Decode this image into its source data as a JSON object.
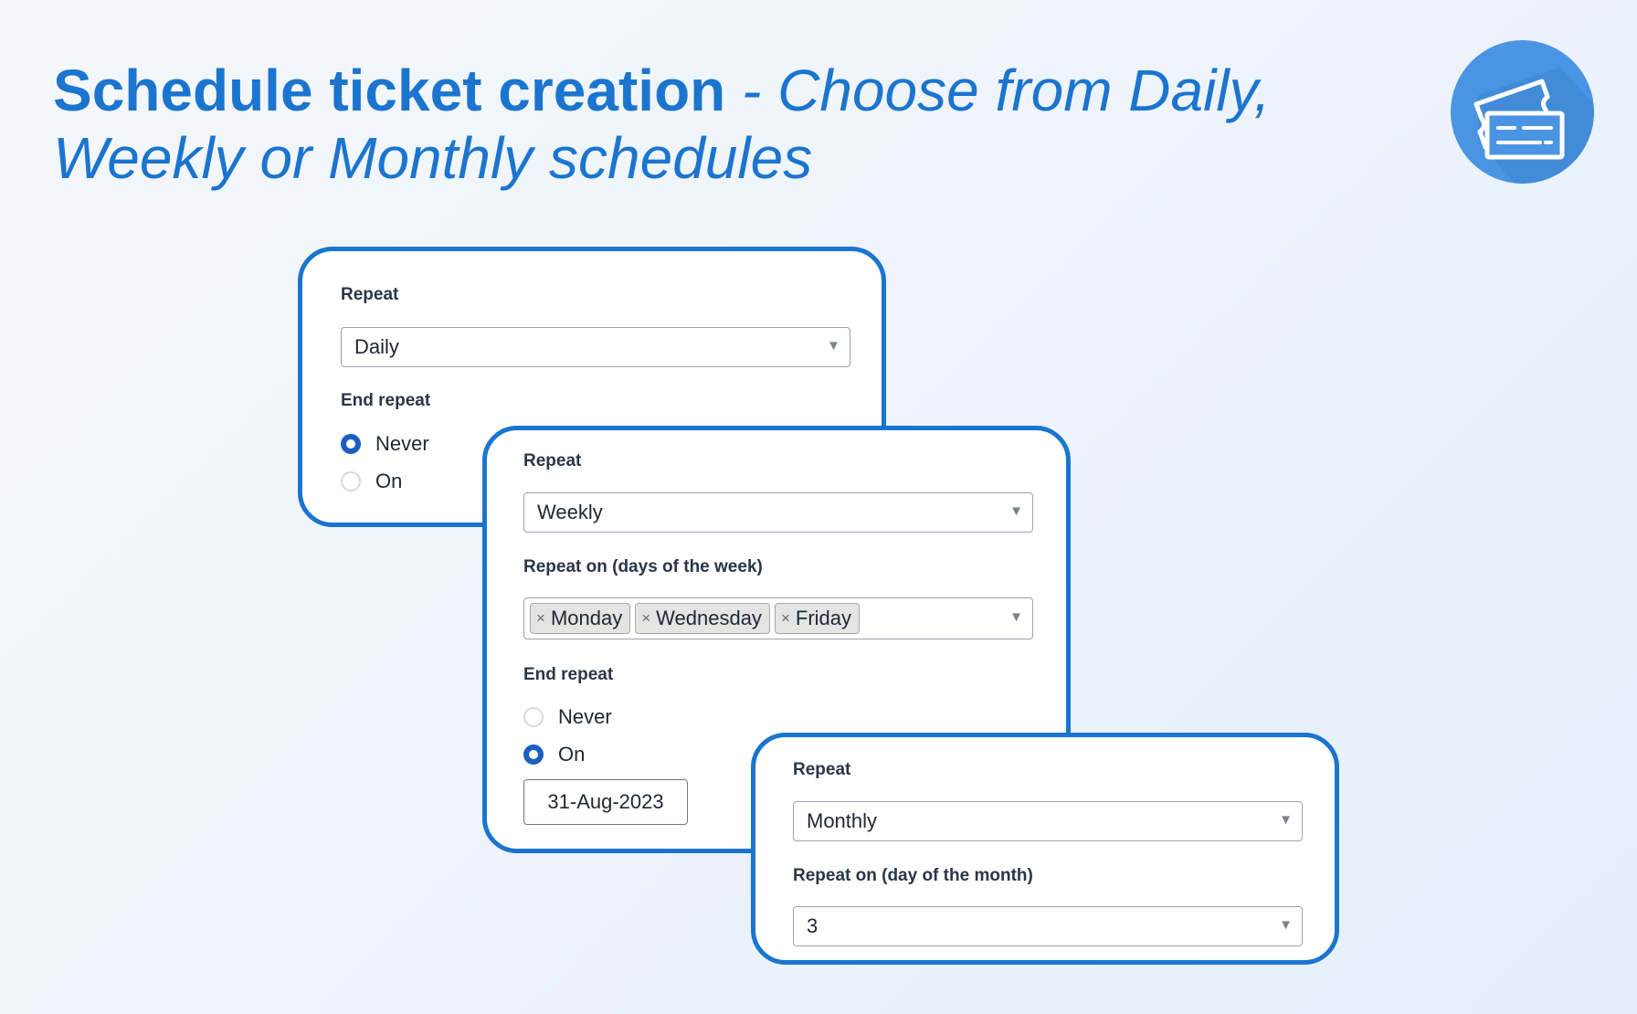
{
  "headline": {
    "bold": "Schedule ticket creation",
    "light_part1": " - Choose from Daily,",
    "light_part2": "Weekly or Monthly schedules"
  },
  "logo": {
    "icon": "ticket-icon",
    "color": "#4a95e3"
  },
  "colors": {
    "accent": "#1b75cf",
    "radio_checked": "#1c5fbe"
  },
  "daily_card": {
    "repeat_label": "Repeat",
    "repeat_value": "Daily",
    "end_repeat_label": "End repeat",
    "options": [
      {
        "label": "Never",
        "checked": true
      },
      {
        "label": "On",
        "checked": false
      }
    ]
  },
  "weekly_card": {
    "repeat_label": "Repeat",
    "repeat_value": "Weekly",
    "days_label": "Repeat on (days of the week)",
    "days": [
      "Monday",
      "Wednesday",
      "Friday"
    ],
    "end_repeat_label": "End repeat",
    "options": [
      {
        "label": "Never",
        "checked": false
      },
      {
        "label": "On",
        "checked": true
      }
    ],
    "end_date": "31-Aug-2023"
  },
  "monthly_card": {
    "repeat_label": "Repeat",
    "repeat_value": "Monthly",
    "day_label": "Repeat on (day of the month)",
    "day_value": "3"
  },
  "symbols": {
    "remove": "×",
    "caret": "▼"
  }
}
